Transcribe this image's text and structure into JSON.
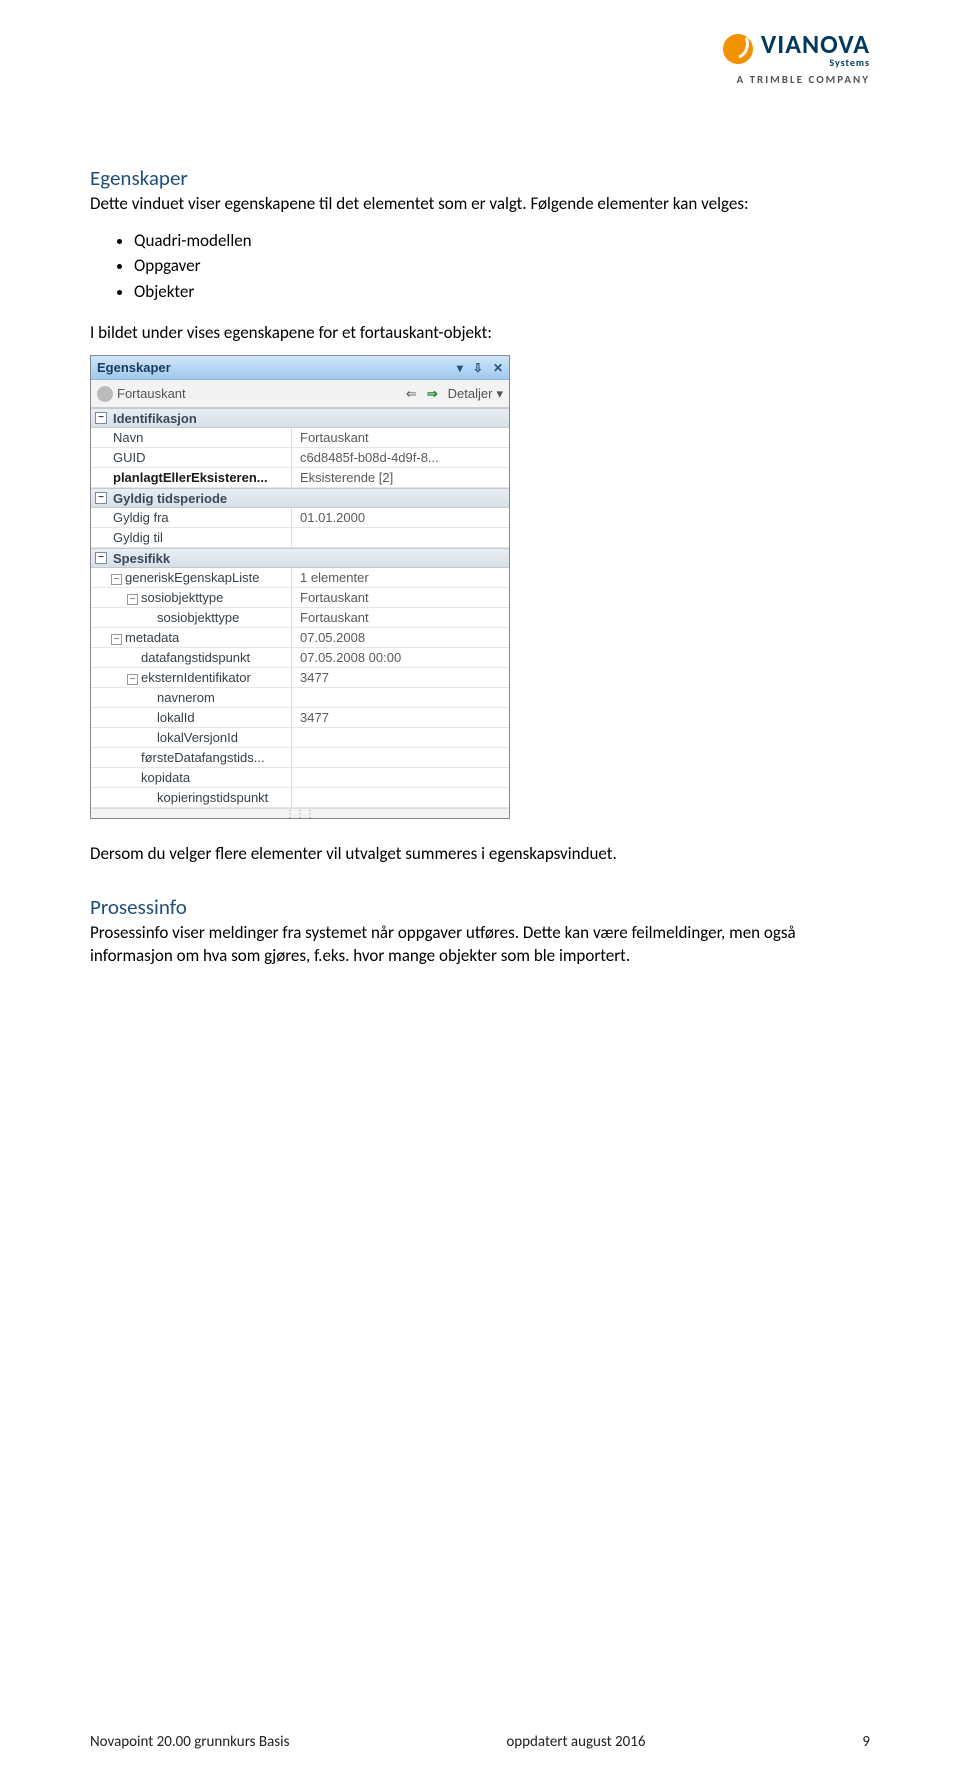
{
  "logo": {
    "brand": "VIANOVA",
    "sub": "Systems",
    "sub2": "A  TRIMBLE  COMPANY"
  },
  "section1": {
    "title": "Egenskaper",
    "intro": "Dette vinduet viser egenskapene til det elementet som er valgt. Følgende elementer kan velges:",
    "bullets": [
      "Quadri-modellen",
      "Oppgaver",
      "Objekter"
    ],
    "caption": "I bildet under vises egenskapene for et fortauskant-objekt:",
    "after": "Dersom du velger flere elementer vil utvalget summeres i egenskapsvinduet."
  },
  "panel": {
    "title": "Egenskaper",
    "title_icons": {
      "drop": "▾",
      "pin": "⇩",
      "close": "✕"
    },
    "toolbar": {
      "obj_label": "Fortauskant",
      "back": "⇐",
      "fwd": "⇒",
      "details": "Detaljer",
      "details_drop": "▾"
    },
    "groups": [
      {
        "name": "Identifikasjon",
        "rows": [
          {
            "k": "Navn",
            "v": "Fortauskant"
          },
          {
            "k": "GUID",
            "v": "c6d8485f-b08d-4d9f-8..."
          },
          {
            "k": "planlagtEllerEksisteren...",
            "v": "Eksisterende [2]",
            "bold": true
          }
        ]
      },
      {
        "name": "Gyldig tidsperiode",
        "rows": [
          {
            "k": "Gyldig fra",
            "v": "01.01.2000"
          },
          {
            "k": "Gyldig til",
            "v": ""
          }
        ]
      },
      {
        "name": "Spesifikk",
        "rows": [
          {
            "k": "generiskEgenskapListe",
            "v": "1 elementer",
            "indent": 1,
            "sub": true
          },
          {
            "k": "sosiobjekttype",
            "v": "Fortauskant",
            "indent": 2,
            "sub": true
          },
          {
            "k": "sosiobjekttype",
            "v": "Fortauskant",
            "indent": 3
          },
          {
            "k": "metadata",
            "v": "07.05.2008",
            "indent": 1,
            "sub": true
          },
          {
            "k": "datafangstidspunkt",
            "v": "07.05.2008 00:00",
            "indent": 2
          },
          {
            "k": "eksternIdentifikator",
            "v": "3477",
            "indent": 2,
            "sub": true
          },
          {
            "k": "navnerom",
            "v": "",
            "indent": 3
          },
          {
            "k": "lokalId",
            "v": "3477",
            "indent": 3
          },
          {
            "k": "lokalVersjonId",
            "v": "",
            "indent": 3
          },
          {
            "k": "førsteDatafangstids...",
            "v": "",
            "indent": 2
          },
          {
            "k": "kopidata",
            "v": "",
            "indent": 2
          },
          {
            "k": "kopieringstidspunkt",
            "v": "",
            "indent": 3
          }
        ]
      }
    ]
  },
  "section2": {
    "title": "Prosessinfo",
    "body": "Prosessinfo viser meldinger fra systemet når oppgaver utføres. Dette kan være feilmeldinger, men også informasjon om hva som gjøres, f.eks. hvor mange objekter som ble importert."
  },
  "footer": {
    "left": "Novapoint 20.00 grunnkurs Basis",
    "center": "oppdatert august 2016",
    "right": "9"
  }
}
